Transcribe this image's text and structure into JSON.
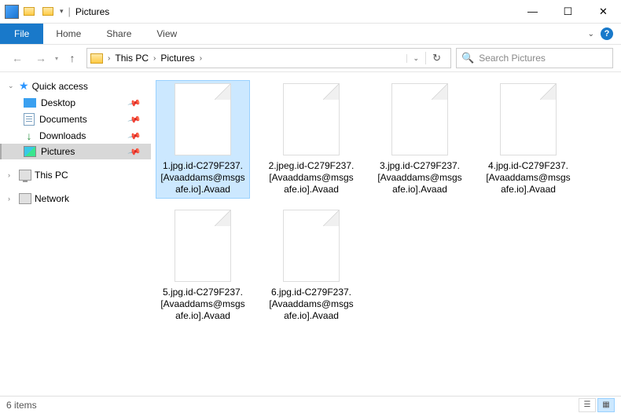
{
  "window": {
    "title": "Pictures"
  },
  "ribbon": {
    "file": "File",
    "tabs": [
      "Home",
      "Share",
      "View"
    ]
  },
  "breadcrumb": {
    "seg1": "This PC",
    "seg2": "Pictures"
  },
  "search": {
    "placeholder": "Search Pictures"
  },
  "sidebar": {
    "quick": "Quick access",
    "items": [
      {
        "label": "Desktop",
        "icon": "blue",
        "pinned": true
      },
      {
        "label": "Documents",
        "icon": "doc",
        "pinned": true
      },
      {
        "label": "Downloads",
        "icon": "dl",
        "pinned": true
      },
      {
        "label": "Pictures",
        "icon": "pic",
        "pinned": true,
        "selected": true
      }
    ],
    "thispc": "This PC",
    "network": "Network"
  },
  "files": [
    {
      "name": "1.jpg.id-C279F237.[Avaaddams@msgsafe.io].Avaad",
      "selected": true
    },
    {
      "name": "2.jpeg.id-C279F237.[Avaaddams@msgsafe.io].Avaad"
    },
    {
      "name": "3.jpg.id-C279F237.[Avaaddams@msgsafe.io].Avaad"
    },
    {
      "name": "4.jpg.id-C279F237.[Avaaddams@msgsafe.io].Avaad"
    },
    {
      "name": "5.jpg.id-C279F237.[Avaaddams@msgsafe.io].Avaad"
    },
    {
      "name": "6.jpg.id-C279F237.[Avaaddams@msgsafe.io].Avaad"
    }
  ],
  "status": {
    "count": "6 items"
  }
}
